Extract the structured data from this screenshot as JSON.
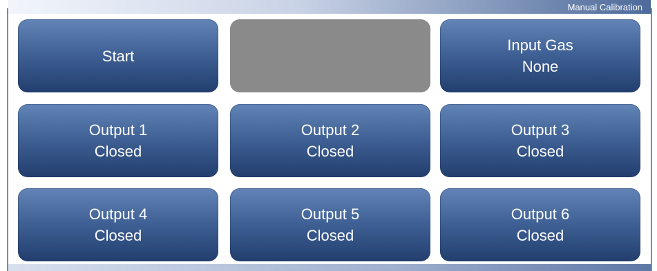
{
  "window": {
    "title": "Manual Calibration"
  },
  "buttons": {
    "start": {
      "label": "Start"
    },
    "input_gas": {
      "label": "Input Gas",
      "value": "None"
    },
    "outputs": [
      {
        "label": "Output 1",
        "state": "Closed"
      },
      {
        "label": "Output 2",
        "state": "Closed"
      },
      {
        "label": "Output 3",
        "state": "Closed"
      },
      {
        "label": "Output 4",
        "state": "Closed"
      },
      {
        "label": "Output 5",
        "state": "Closed"
      },
      {
        "label": "Output 6",
        "state": "Closed"
      }
    ]
  },
  "colors": {
    "button_top": "#6284b6",
    "button_bottom": "#223e6e",
    "disabled": "#8a8a8a"
  }
}
